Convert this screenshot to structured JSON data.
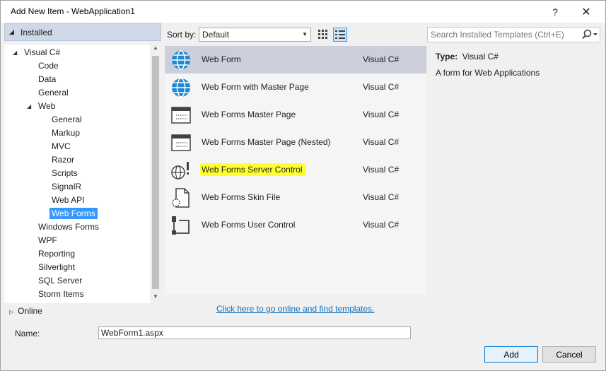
{
  "window": {
    "title": "Add New Item - WebApplication1",
    "help_glyph": "?",
    "close_glyph": "✕"
  },
  "left": {
    "installed_label": "Installed",
    "tree": {
      "visual_csharp": "Visual C#",
      "code": "Code",
      "data": "Data",
      "general": "General",
      "web": "Web",
      "web_general": "General",
      "markup": "Markup",
      "mvc": "MVC",
      "razor": "Razor",
      "scripts": "Scripts",
      "signalr": "SignalR",
      "web_api": "Web API",
      "web_forms": "Web Forms",
      "windows_forms": "Windows Forms",
      "wpf": "WPF",
      "reporting": "Reporting",
      "silverlight": "Silverlight",
      "sql_server": "SQL Server",
      "storm_items": "Storm Items"
    },
    "online_label": "Online"
  },
  "toolbar": {
    "sort_label": "Sort by:",
    "sort_value": "Default"
  },
  "templates": [
    {
      "name": "Web Form",
      "lang": "Visual C#",
      "icon": "globe-icon"
    },
    {
      "name": "Web Form with Master Page",
      "lang": "Visual C#",
      "icon": "globe-icon"
    },
    {
      "name": "Web Forms Master Page",
      "lang": "Visual C#",
      "icon": "master-page-icon"
    },
    {
      "name": "Web Forms Master Page (Nested)",
      "lang": "Visual C#",
      "icon": "master-page-icon"
    },
    {
      "name": "Web Forms Server Control",
      "lang": "Visual C#",
      "icon": "server-control-icon"
    },
    {
      "name": "Web Forms Skin File",
      "lang": "Visual C#",
      "icon": "skin-file-icon"
    },
    {
      "name": "Web Forms User Control",
      "lang": "Visual C#",
      "icon": "user-control-icon"
    }
  ],
  "online_link": "Click here to go online and find templates.",
  "search": {
    "placeholder": "Search Installed Templates (Ctrl+E)"
  },
  "details": {
    "type_label": "Type:",
    "type_value": "Visual C#",
    "description": "A form for Web Applications"
  },
  "bottom": {
    "name_label": "Name:",
    "name_value": "WebForm1.aspx",
    "add_label": "Add",
    "cancel_label": "Cancel"
  },
  "colors": {
    "selected_row": "#cccedb",
    "tree_selection": "#3399ff",
    "highlight": "#ffff33",
    "link": "#0e70c0"
  }
}
